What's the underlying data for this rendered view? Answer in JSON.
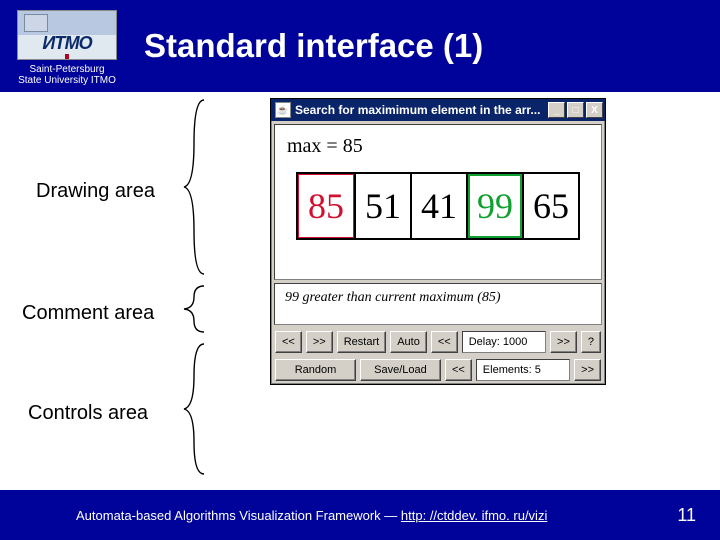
{
  "header": {
    "logo_acronym": "ИТМО",
    "org_line1": "Saint-Petersburg",
    "org_line2": "State University ITMO",
    "title": "Standard interface (1)"
  },
  "labels": {
    "drawing": "Drawing area",
    "comment": "Comment area",
    "controls": "Controls area"
  },
  "app": {
    "title": "Search for maximimum element in the arr...",
    "titlebar_icon": "☕",
    "min_glyph": "_",
    "max_glyph": "□",
    "close_glyph": "X",
    "max_line": "max = 85",
    "cells": [
      "85",
      "51",
      "41",
      "99",
      "65"
    ],
    "comment_text": "99 greater than current maximum (85)",
    "buttons_row1": {
      "first": "<<",
      "next": ">>",
      "restart": "Restart",
      "auto": "Auto",
      "delay_prev": "<<",
      "delay_field": "Delay: 1000",
      "delay_next": ">>",
      "help": "?"
    },
    "buttons_row2": {
      "random": "Random",
      "saveload": "Save/Load",
      "elem_prev": "<<",
      "elem_field": "Elements: 5",
      "elem_next": ">>"
    }
  },
  "footer": {
    "text_prefix": "Automata-based Algorithms Visualization Framework — ",
    "link": "http: //ctddev. ifmo. ru/vizi",
    "page": "11"
  }
}
